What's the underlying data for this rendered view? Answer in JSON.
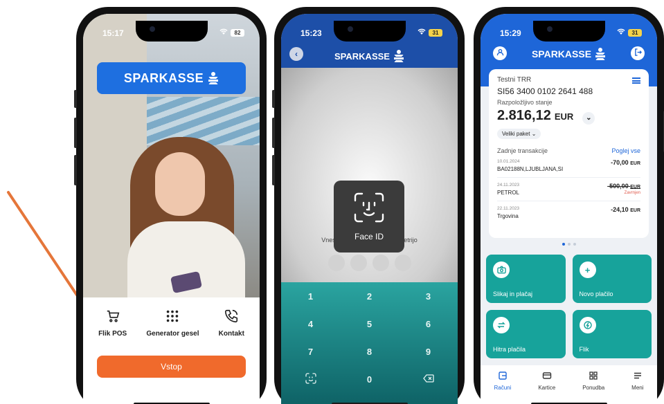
{
  "colors": {
    "brand_blue": "#1e66d8",
    "action_orange": "#f06a2c",
    "teal": "#17a39b",
    "annotation_arrow": "#e5763a"
  },
  "phone1": {
    "status_time": "15:17",
    "battery": "82",
    "brand": "SPARKASSE",
    "quick_actions": [
      {
        "label": "Flik POS",
        "icon": "cart-icon"
      },
      {
        "label": "Generator gesel",
        "icon": "grid-dots-icon"
      },
      {
        "label": "Kontakt",
        "icon": "phone-icon"
      }
    ],
    "primary_button": "Vstop"
  },
  "phone2": {
    "status_time": "15:23",
    "battery": "31",
    "brand": "SPARKASSE",
    "prompt": "Vnesi",
    "prompt_suffix": "metrijo",
    "face_id_label": "Face ID",
    "keys": [
      "1",
      "2",
      "3",
      "4",
      "5",
      "6",
      "7",
      "8",
      "9",
      "",
      "0",
      ""
    ]
  },
  "phone3": {
    "status_time": "15:29",
    "battery": "31",
    "brand": "SPARKASSE",
    "account": {
      "name": "Testni TRR",
      "iban": "SI56 3400 0102 2641 488",
      "available_label": "Razpoložljivo stanje",
      "balance": "2.816,12",
      "currency": "EUR",
      "package": "Veliki paket"
    },
    "transactions_label": "Zadnje transakcije",
    "view_all": "Poglej vse",
    "transactions": [
      {
        "date": "10.01.2024",
        "desc": "BA02188N,LJUBLJANA,SI",
        "amount": "-70,00",
        "currency": "EUR",
        "status": ""
      },
      {
        "date": "24.11.2023",
        "desc": "PETROL",
        "amount": "-500,00",
        "currency": "EUR",
        "status": "Zavrnjen"
      },
      {
        "date": "22.11.2023",
        "desc": "Trgovina",
        "amount": "-24,10",
        "currency": "EUR",
        "status": ""
      }
    ],
    "tiles": [
      {
        "label": "Slikaj in plačaj",
        "icon": "camera-icon"
      },
      {
        "label": "Novo plačilo",
        "icon": "plus-icon"
      },
      {
        "label": "Hitra plačila",
        "icon": "swap-icon"
      },
      {
        "label": "Flik",
        "icon": "flik-icon"
      }
    ],
    "nav": [
      {
        "label": "Računi",
        "icon": "accounts-icon",
        "active": true
      },
      {
        "label": "Kartice",
        "icon": "card-icon",
        "active": false
      },
      {
        "label": "Ponudba",
        "icon": "offer-grid-icon",
        "active": false
      },
      {
        "label": "Meni",
        "icon": "menu-icon",
        "active": false
      }
    ]
  }
}
